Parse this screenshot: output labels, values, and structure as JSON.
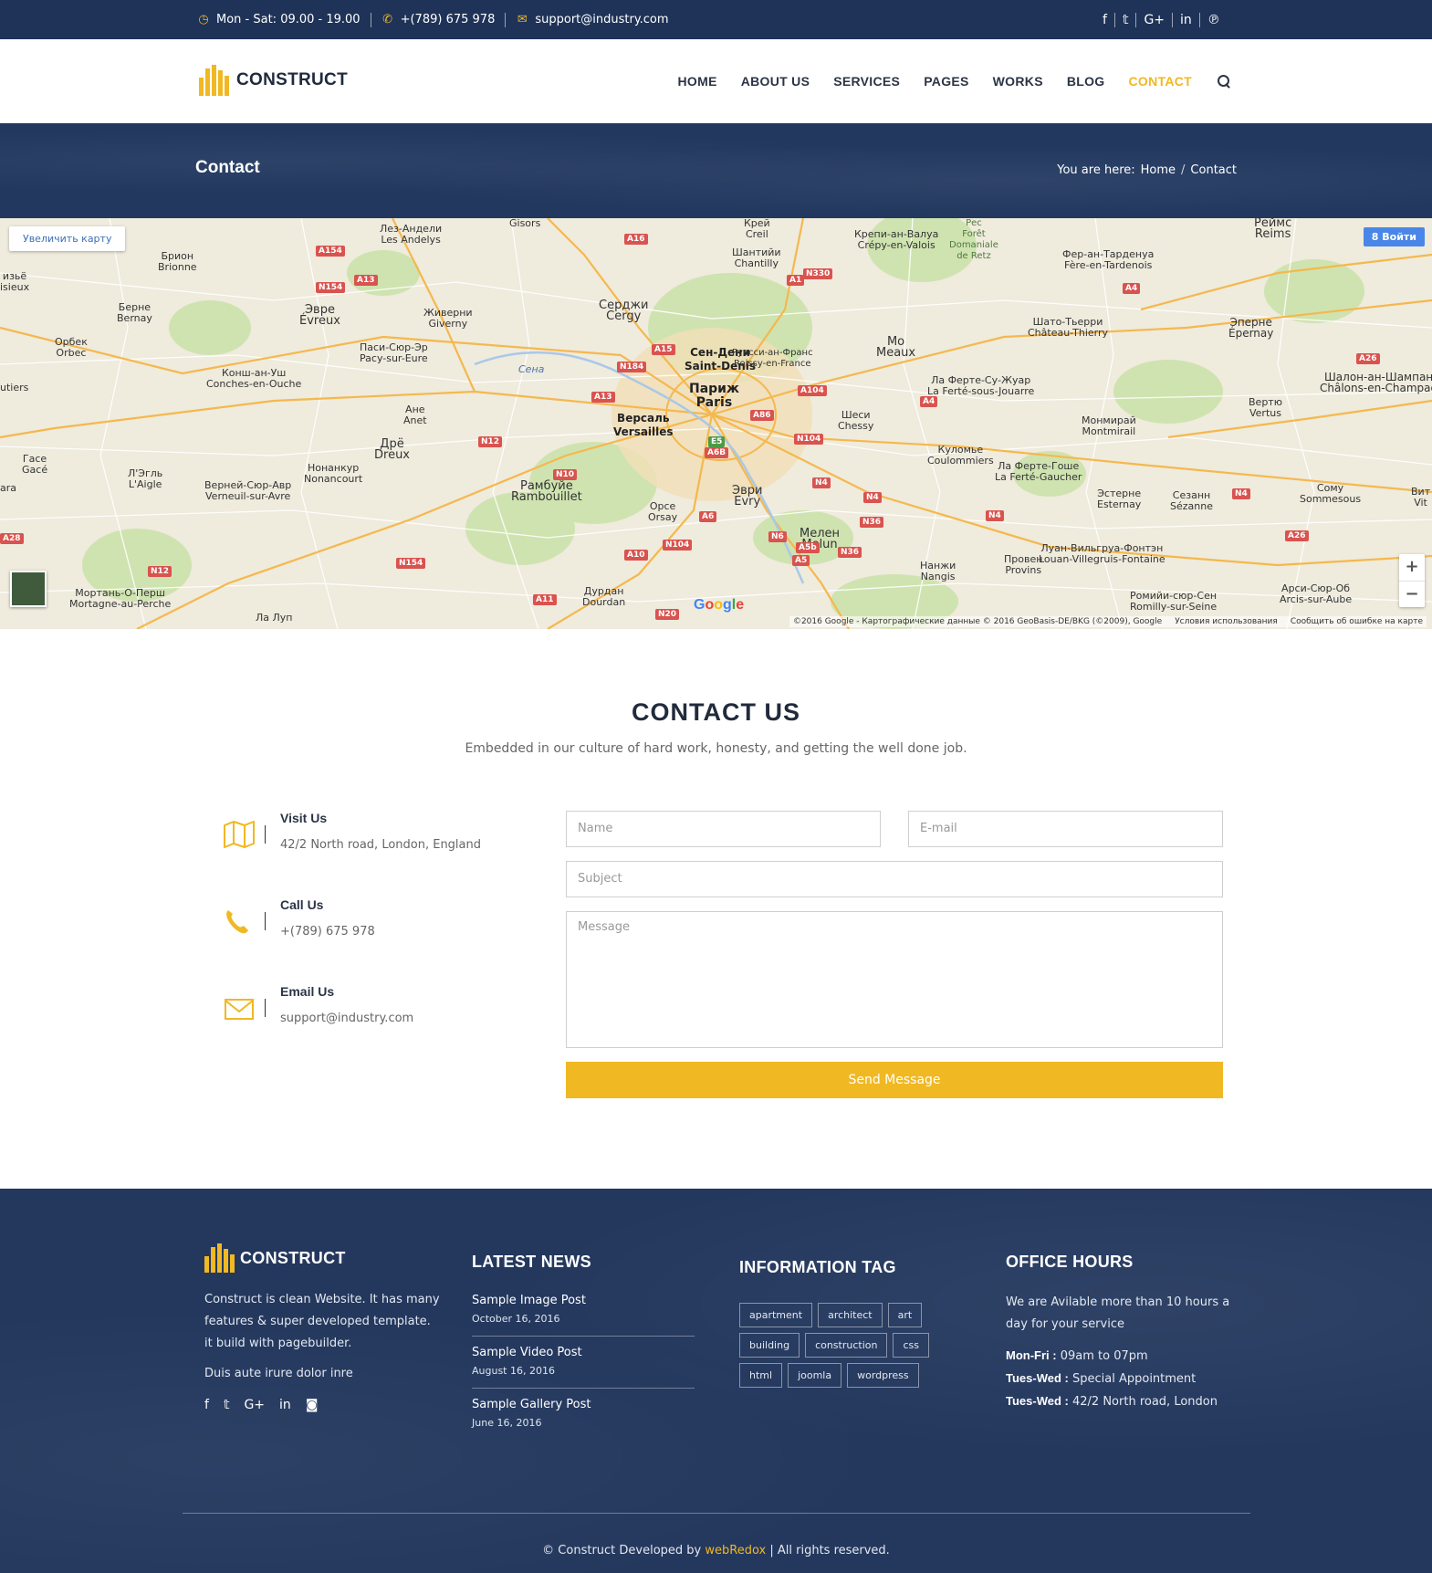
{
  "topbar": {
    "hours": "Mon - Sat: 09.00 - 19.00",
    "phone": "+(789) 675 978",
    "email": "support@industry.com",
    "social_icons": [
      "facebook-icon",
      "twitter-icon",
      "google-plus-icon",
      "linkedin-icon",
      "pinterest-icon"
    ]
  },
  "header": {
    "logo": "CONSTRUCT",
    "nav": [
      "HOME",
      "ABOUT US",
      "SERVICES",
      "PAGES",
      "WORKS",
      "BLOG",
      "CONTACT"
    ],
    "active": "CONTACT"
  },
  "titlebar": {
    "title": "Contact",
    "crumb_prefix": "You are here:",
    "crumb_home": "Home",
    "crumb_sep": "/",
    "crumb_current": "Contact"
  },
  "map": {
    "enlarge": "Увеличить карту",
    "signin": "Войти",
    "zoom_in": "+",
    "zoom_out": "−",
    "google": "Google",
    "attrib_data": "©2016 Google - Картографические данные © 2016 GeoBasis-DE/BKG (©2009), Google",
    "attrib_terms": "Условия использования",
    "attrib_report": "Сообщить об ошибке на карте",
    "labels": {
      "paris": "Париж\nParis",
      "versailles": "Версаль\nVersailles",
      "saint_denis": "Сен-Дени\nSaint-Denis",
      "cergy": "Серджи\nCergy",
      "meaux": "Мо\nMeaux",
      "evreux": "Эвре\nÉvreux",
      "dreux": "Дрё\nDreux",
      "rambouillet": "Рамбуйе\nRambouillet",
      "melun": "Мелен\nMelun",
      "evry": "Эври\nEvry",
      "chantilly": "Шантийи\nChantilly",
      "creil": "Крей\nCreil",
      "reims": "Реймс\nReims",
      "epernay": "Эперне\nÉpernay",
      "chateau_thierry": "Шато-Тьерри\nChâteau-Thierry",
      "coulommiers": "Куломье\nCoulommiers",
      "nangis": "Нанжи\nNangis",
      "provins": "Провен\nProvins",
      "orsay": "Орсе\nOrsay",
      "dourdan": "Дурдан\nDourdan",
      "giverny": "Живерни\nGiverny",
      "les_andelys": "Лез-Андели\nLes Andelys",
      "gisors": "Gisors",
      "crepy": "Крепи-ан-Валуа\nCrépy-en-Valois",
      "pacy": "Паси-Сюр-Эр\nPacy-sur-Eure",
      "montmirail": "Монмирай\nMontmirail",
      "sezanne": "Сезанн\nSézanne",
      "esternay": "Эстерне\nEsternay",
      "chalons": "Шалон-ан-Шампан\nChâlons-en-Champag",
      "vertus": "Вертю\nVertus",
      "sommesous": "Сому\nSommesous",
      "romilly": "Ромийи-сюр-Сен\nRomilly-sur-Seine",
      "arcis": "Арси-Сюр-Об\nArcis-sur-Aube",
      "mortagne": "Мортань-О-Перш\nMortagne-au-Perche",
      "brionne": "Брион\nBrionne",
      "bernay": "Берне\nBernay",
      "orbec": "Орбек\nOrbec",
      "conches": "Конш-ан-Уш\nConches-en-Ouche",
      "laigle": "Л'Эгль\nL'Aigle",
      "verneuil": "Верней-Сюр-Авр\nVerneuil-sur-Avre",
      "nonancourt": "Нонанкур\nNonancourt",
      "anet": "Ане\nAnet",
      "chessy": "Шеси\nChessy",
      "roissy": "Руасси-ан-Франс\nRoissy-en-France",
      "la_ferte_jouarre": "Ла Ферте-Су-Жуар\nLa Ferté-sous-Jouarre",
      "la_ferte_gaucher": "Ла Ферте-Гоше\nLa Ferté-Gaucher",
      "louan": "Луан-Вильгруа-Фонтэн\nLouan-Villegruis-Fontaine",
      "fere": "Фер-ан-Тарденуа\nFère-en-Tardenois",
      "foret": "Рес\nForêt\nDomaniale\nde Retz",
      "seine": "Сена",
      "la_loupe": "Ла Луп",
      "isieux": "изьё\nisieux",
      "gace": "Гасе\nGacé",
      "tiers": "utiers",
      "ara": "ara",
      "vit": "Вит\nVit"
    },
    "roads": [
      "A154",
      "N154",
      "A13",
      "A16",
      "N330",
      "A1",
      "A4",
      "A15",
      "N184",
      "A13",
      "A104",
      "A86",
      "E5",
      "A6B",
      "N104",
      "N12",
      "N10",
      "A6",
      "N104",
      "A10",
      "N6",
      "A5b",
      "A5",
      "N36",
      "N4",
      "N4",
      "N36",
      "N4",
      "A4",
      "A26",
      "A26",
      "N4",
      "A28",
      "N12",
      "N154",
      "A11",
      "N20"
    ]
  },
  "contact": {
    "title": "CONTACT US",
    "subtitle": "Embedded in our culture of hard work, honesty, and getting the well done job.",
    "items": [
      {
        "title": "Visit Us",
        "value": "42/2 North road, London, England",
        "icon": "map-icon"
      },
      {
        "title": "Call Us",
        "value": "+(789) 675 978",
        "icon": "phone-icon"
      },
      {
        "title": "Email Us",
        "value": "support@industry.com",
        "icon": "envelope-icon"
      }
    ],
    "form": {
      "name_placeholder": "Name",
      "email_placeholder": "E-mail",
      "subject_placeholder": "Subject",
      "message_placeholder": "Message",
      "submit": "Send Message"
    }
  },
  "footer": {
    "logo": "CONSTRUCT",
    "about": "Construct is clean Website. It has many features & super developed template. it build with pagebuilder.",
    "about_extra": "Duis aute irure dolor inre",
    "social_icons": [
      "facebook-icon",
      "twitter-icon",
      "google-plus-icon",
      "linkedin-icon",
      "instagram-icon"
    ],
    "news_title": "LATEST NEWS",
    "news": [
      {
        "title": "Sample Image Post",
        "date": "October 16, 2016"
      },
      {
        "title": "Sample Video Post",
        "date": "August 16, 2016"
      },
      {
        "title": "Sample Gallery Post",
        "date": "June 16, 2016"
      }
    ],
    "tags_title": "INFORMATION TAG",
    "tags": [
      "apartment",
      "architect",
      "art",
      "building",
      "construction",
      "css",
      "html",
      "joomla",
      "wordpress"
    ],
    "hours_title": "OFFICE HOURS",
    "hours_intro": "We are Avilable more than 10 hours a day for your service",
    "hours": [
      {
        "label": "Mon-Fri :",
        "value": "09am to 07pm"
      },
      {
        "label": "Tues-Wed :",
        "value": "Special Appointment"
      },
      {
        "label": "Tues-Wed :",
        "value": "42/2 North road, London"
      }
    ],
    "copyright_pre": "© Construct Developed by",
    "copyright_brand": "webRedox",
    "copyright_post": "| All rights reserved."
  },
  "colors": {
    "accent": "#f0b823",
    "navy": "#1f3358",
    "footer": "#24385e"
  }
}
